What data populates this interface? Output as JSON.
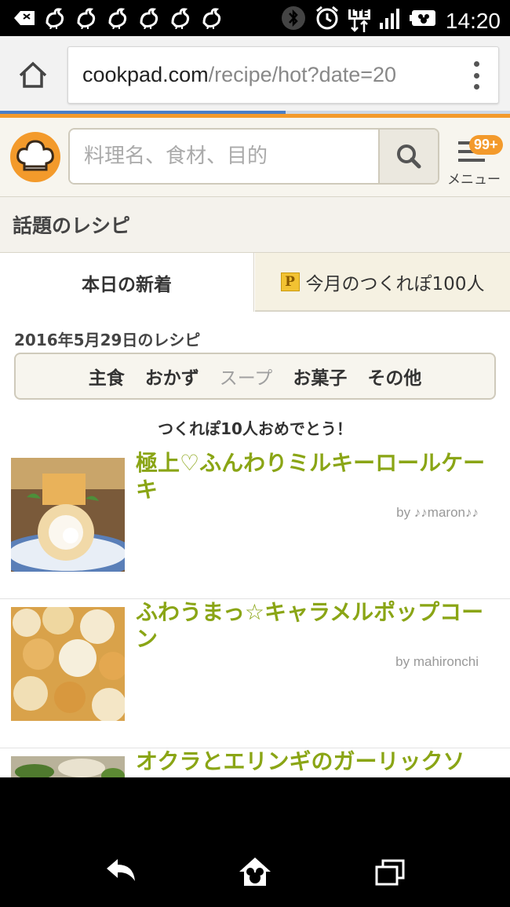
{
  "status_bar": {
    "time": "14:20",
    "network": "LTE",
    "notification_icons": [
      "bird-icon",
      "bird-icon",
      "bird-icon",
      "bird-icon",
      "bird-icon",
      "bird-icon"
    ]
  },
  "browser": {
    "url_host": "cookpad.com",
    "url_path": "/recipe/hot?date=20",
    "load_progress": 0.56
  },
  "header": {
    "search_placeholder": "料理名、食材、目的",
    "menu_badge": "99+",
    "menu_label": "メニュー"
  },
  "section_title": "話題のレシピ",
  "tabs": [
    {
      "label": "本日の新着",
      "active": true
    },
    {
      "label": "今月のつくれぽ100人",
      "active": false,
      "icon": "P"
    }
  ],
  "date_label": "2016年5月29日のレシピ",
  "categories": [
    {
      "label": "主食",
      "enabled": true
    },
    {
      "label": "おかず",
      "enabled": true
    },
    {
      "label": "スープ",
      "enabled": false
    },
    {
      "label": "お菓子",
      "enabled": true
    },
    {
      "label": "その他",
      "enabled": true
    }
  ],
  "congrats": "つくれぽ10人おめでとう！",
  "recipes": [
    {
      "title": "極上♡ふんわりミルキーロールケーキ",
      "author": "by ♪♪maron♪♪"
    },
    {
      "title": "ふわうまっ☆キャラメルポップコーン",
      "author": "by mahironchi"
    },
    {
      "title": "オクラとエリンギのガーリックソ",
      "author": ""
    }
  ],
  "colors": {
    "brand_orange": "#f39a2b",
    "recipe_title_green": "#8aa515"
  }
}
